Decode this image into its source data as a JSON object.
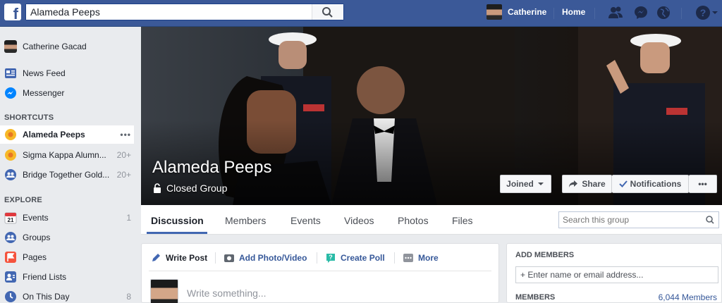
{
  "topbar": {
    "logo": "f",
    "search_value": "Alameda Peeps",
    "user_name": "Catherine",
    "home_label": "Home",
    "icons": [
      "friends-icon",
      "messenger-icon",
      "globe-icon",
      "help-icon"
    ]
  },
  "sidebar": {
    "profile_name": "Catherine Gacad",
    "top_items": [
      {
        "label": "News Feed",
        "icon": "news-feed-icon"
      },
      {
        "label": "Messenger",
        "icon": "messenger-icon"
      }
    ],
    "shortcuts_heading": "SHORTCUTS",
    "shortcuts": [
      {
        "label": "Alameda Peeps",
        "count": "",
        "more": "•••"
      },
      {
        "label": "Sigma Kappa Alumn...",
        "count": "20+"
      },
      {
        "label": "Bridge Together Gold...",
        "count": "20+"
      }
    ],
    "explore_heading": "EXPLORE",
    "explore": [
      {
        "label": "Events",
        "count": "1",
        "icon_text": "21"
      },
      {
        "label": "Groups",
        "count": ""
      },
      {
        "label": "Pages",
        "count": ""
      },
      {
        "label": "Friend Lists",
        "count": ""
      },
      {
        "label": "On This Day",
        "count": "8"
      }
    ]
  },
  "cover": {
    "group_name": "Alameda Peeps",
    "privacy": "Closed Group",
    "joined_label": "Joined",
    "share_label": "Share",
    "notifications_label": "Notifications",
    "more_label": "•••"
  },
  "tabs": [
    {
      "label": "Discussion",
      "active": true
    },
    {
      "label": "Members"
    },
    {
      "label": "Events"
    },
    {
      "label": "Videos"
    },
    {
      "label": "Photos"
    },
    {
      "label": "Files"
    }
  ],
  "group_search": {
    "placeholder": "Search this group"
  },
  "composer": {
    "write_post": "Write Post",
    "add_photo": "Add Photo/Video",
    "create_poll": "Create Poll",
    "more": "More",
    "placeholder": "Write something..."
  },
  "right_panel": {
    "add_members_heading": "ADD MEMBERS",
    "add_members_placeholder": "+ Enter name or email address...",
    "members_heading": "MEMBERS",
    "members_count": "6,044 Members"
  },
  "colors": {
    "brand": "#3b5998",
    "link": "#365899",
    "tab_active": "#4267b2"
  }
}
